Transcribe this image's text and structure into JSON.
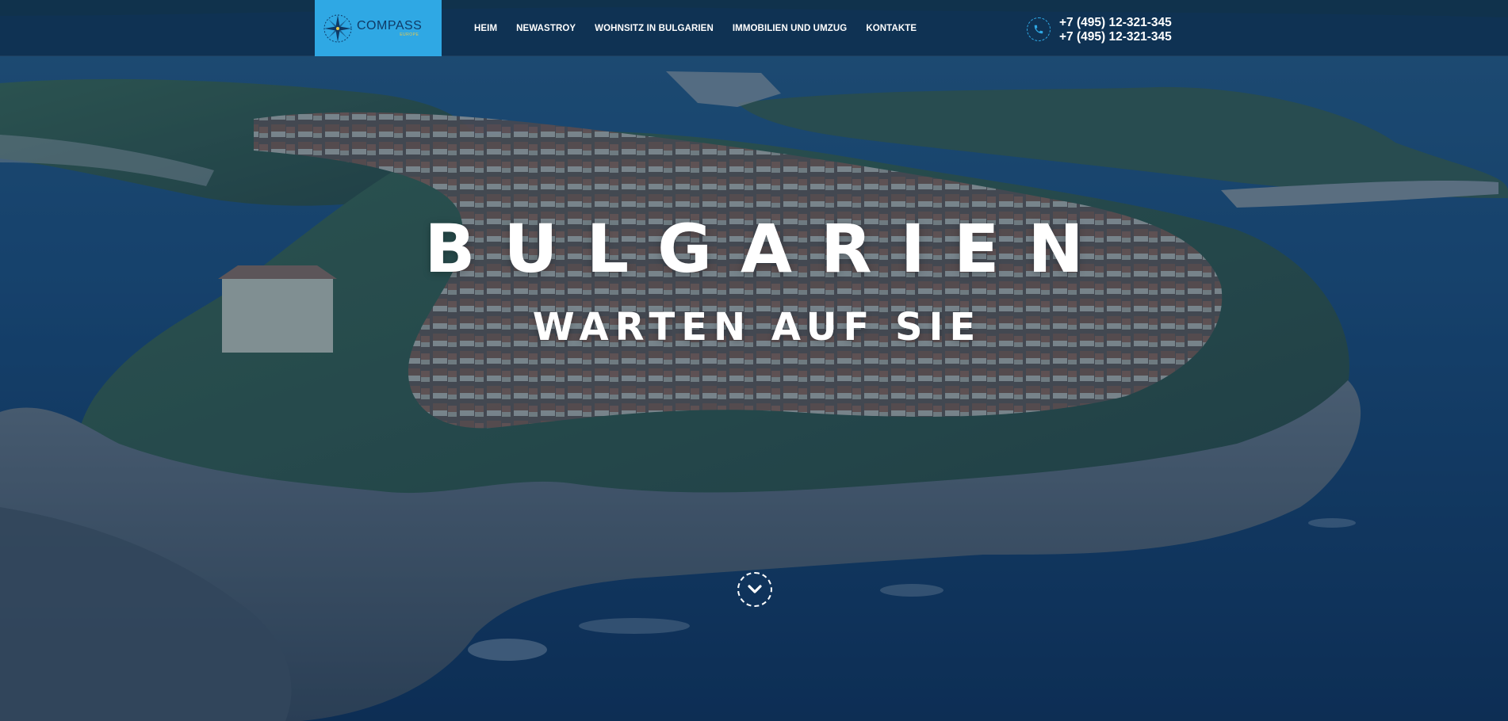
{
  "brand": {
    "name": "COMPASS",
    "sub": "EUROPE",
    "accent_color": "#2fa8e4"
  },
  "nav": {
    "items": [
      {
        "label": "HEIM"
      },
      {
        "label": "NEWASTROY"
      },
      {
        "label": "WOHNSITZ IN BULGARIEN"
      },
      {
        "label": "IMMOBILIEN UND UMZUG"
      },
      {
        "label": "KONTAKTE"
      }
    ]
  },
  "contact": {
    "icon": "phone-icon",
    "phones": [
      "+7 (495) 12-321-345",
      "+7 (495) 12-321-345"
    ]
  },
  "hero": {
    "title": "BULGARIEN",
    "subtitle": "WARTEN AUF SIE",
    "scroll_icon": "chevron-down-icon"
  }
}
